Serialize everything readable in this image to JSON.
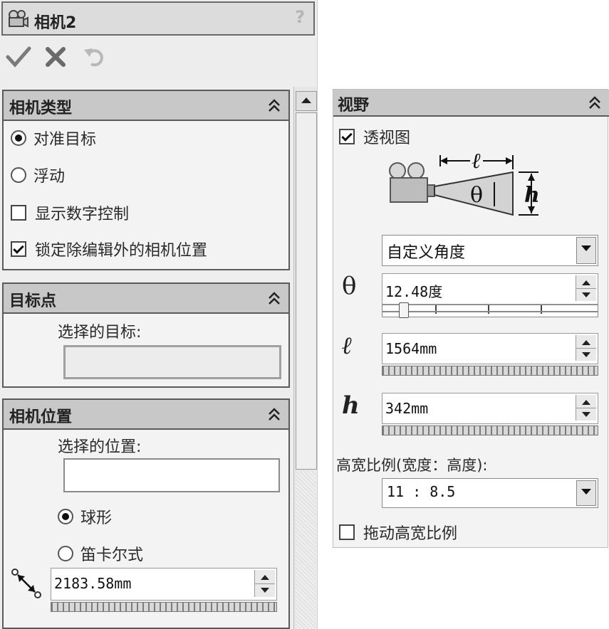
{
  "header": {
    "title": "相机2",
    "help": "?"
  },
  "toolbar": {
    "ok_icon": "checkmark-icon",
    "cancel_icon": "x-icon",
    "undo_icon": "undo-icon"
  },
  "camera_type": {
    "title": "相机类型",
    "options": [
      "对准目标",
      "浮动"
    ],
    "selected": "对准目标",
    "checkboxes": [
      {
        "label": "显示数字控制",
        "checked": false
      },
      {
        "label": "锁定除编辑外的相机位置",
        "checked": true
      }
    ]
  },
  "target_point": {
    "title": "目标点",
    "select_label": "选择的目标:",
    "value": ""
  },
  "camera_position": {
    "title": "相机位置",
    "select_label": "选择的位置:",
    "value": "",
    "options": [
      "球形",
      "笛卡尔式"
    ],
    "selected": "球形",
    "distance": "2183.58mm"
  },
  "field_of_view": {
    "title": "视野",
    "perspective_label": "透视图",
    "perspective_checked": true,
    "diagram": {
      "l": "ℓ",
      "h": "h",
      "theta": "θ"
    },
    "preset": "自定义角度",
    "theta_symbol": "θ",
    "theta_value": "12.48度",
    "theta_slider_fraction": 0.08,
    "l_symbol": "ℓ",
    "l_value": "1564mm",
    "h_symbol": "h",
    "h_value": "342mm",
    "aspect_label": "高宽比例(宽度：高度):",
    "aspect_value": "11 : 8.5",
    "drag_aspect_label": "拖动高宽比例",
    "drag_aspect_checked": false
  },
  "colors": {
    "panel_header": "#c8c8c8",
    "panel_bg": "#f3f3f3",
    "border": "#5a5a5a"
  }
}
